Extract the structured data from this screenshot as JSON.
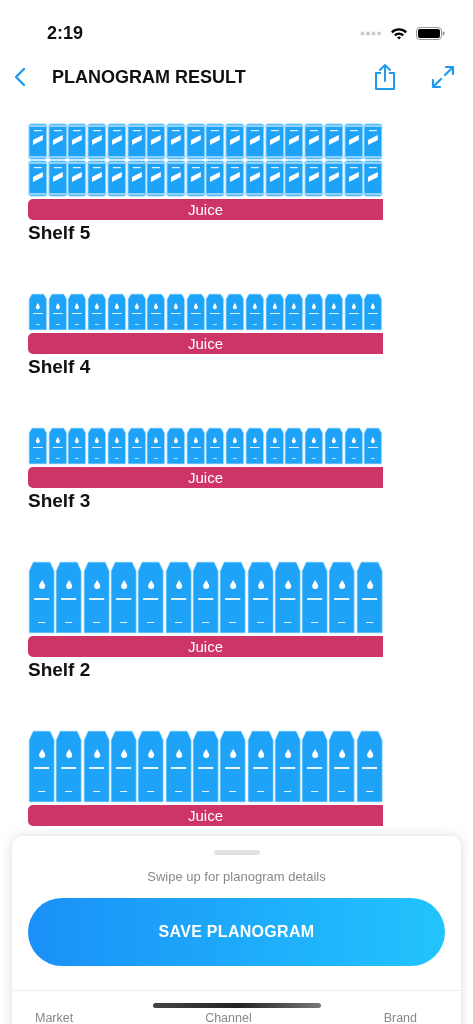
{
  "status_bar": {
    "time": "2:19"
  },
  "nav": {
    "title": "PLANOGRAM RESULT"
  },
  "shelves": [
    {
      "label": "Shelf 5",
      "category": "Juice",
      "rows": [
        [
          {
            "kind": "can"
          },
          {
            "kind": "can"
          },
          {
            "kind": "can"
          },
          {
            "kind": "can"
          },
          {
            "kind": "can"
          },
          {
            "kind": "can"
          },
          {
            "kind": "can"
          },
          {
            "kind": "can"
          },
          {
            "kind": "can"
          },
          {
            "kind": "can"
          },
          {
            "kind": "can"
          },
          {
            "kind": "can"
          },
          {
            "kind": "can"
          },
          {
            "kind": "can"
          },
          {
            "kind": "can"
          },
          {
            "kind": "can"
          },
          {
            "kind": "can"
          },
          {
            "kind": "can"
          }
        ],
        [
          {
            "kind": "can"
          },
          {
            "kind": "can"
          },
          {
            "kind": "can"
          },
          {
            "kind": "can"
          },
          {
            "kind": "can"
          },
          {
            "kind": "can"
          },
          {
            "kind": "can"
          },
          {
            "kind": "can"
          },
          {
            "kind": "can"
          },
          {
            "kind": "can"
          },
          {
            "kind": "can"
          },
          {
            "kind": "can"
          },
          {
            "kind": "can"
          },
          {
            "kind": "can"
          },
          {
            "kind": "can"
          },
          {
            "kind": "can"
          },
          {
            "kind": "can"
          },
          {
            "kind": "can"
          }
        ]
      ]
    },
    {
      "label": "Shelf 4",
      "category": "Juice",
      "rows": [
        [
          {
            "kind": "carton-small"
          },
          {
            "kind": "carton-small"
          },
          {
            "kind": "carton-small"
          },
          {
            "kind": "carton-small"
          },
          {
            "kind": "carton-small"
          },
          {
            "kind": "carton-small"
          },
          {
            "kind": "carton-small"
          },
          {
            "kind": "carton-small"
          },
          {
            "kind": "carton-small"
          },
          {
            "kind": "carton-small"
          },
          {
            "kind": "carton-small"
          },
          {
            "kind": "carton-small"
          },
          {
            "kind": "carton-small"
          },
          {
            "kind": "carton-small"
          },
          {
            "kind": "carton-small"
          },
          {
            "kind": "carton-small"
          },
          {
            "kind": "carton-small"
          },
          {
            "kind": "carton-small"
          }
        ]
      ]
    },
    {
      "label": "Shelf 3",
      "category": "Juice",
      "rows": [
        [
          {
            "kind": "carton-small"
          },
          {
            "kind": "carton-small"
          },
          {
            "kind": "carton-small"
          },
          {
            "kind": "carton-small"
          },
          {
            "kind": "carton-small"
          },
          {
            "kind": "carton-small"
          },
          {
            "kind": "carton-small"
          },
          {
            "kind": "carton-small"
          },
          {
            "kind": "carton-small"
          },
          {
            "kind": "carton-small"
          },
          {
            "kind": "carton-small"
          },
          {
            "kind": "carton-small"
          },
          {
            "kind": "carton-small"
          },
          {
            "kind": "carton-small"
          },
          {
            "kind": "carton-small"
          },
          {
            "kind": "carton-small"
          },
          {
            "kind": "carton-small"
          },
          {
            "kind": "carton-small"
          }
        ]
      ]
    },
    {
      "label": "Shelf 2",
      "category": "Juice",
      "rows": [
        [
          {
            "kind": "carton-large"
          },
          {
            "kind": "carton-large"
          },
          {
            "kind": "carton-large"
          },
          {
            "kind": "carton-large"
          },
          {
            "kind": "carton-large"
          },
          {
            "kind": "carton-large"
          },
          {
            "kind": "carton-large"
          },
          {
            "kind": "carton-large"
          },
          {
            "kind": "carton-large"
          },
          {
            "kind": "carton-large"
          },
          {
            "kind": "carton-large"
          },
          {
            "kind": "carton-large"
          },
          {
            "kind": "carton-large"
          }
        ]
      ]
    },
    {
      "category": "Juice",
      "rows": [
        [
          {
            "kind": "carton-large"
          },
          {
            "kind": "carton-large"
          },
          {
            "kind": "carton-large"
          },
          {
            "kind": "carton-large"
          },
          {
            "kind": "carton-large"
          },
          {
            "kind": "carton-large"
          },
          {
            "kind": "carton-large"
          },
          {
            "kind": "carton-large"
          },
          {
            "kind": "carton-large"
          },
          {
            "kind": "carton-large"
          },
          {
            "kind": "carton-large"
          },
          {
            "kind": "carton-large"
          },
          {
            "kind": "carton-large"
          }
        ]
      ]
    }
  ],
  "sheet": {
    "hint": "Swipe up for planogram details",
    "save_button": "SAVE PLANOGRAM",
    "tabs": [
      "Market",
      "Channel",
      "Brand"
    ]
  }
}
